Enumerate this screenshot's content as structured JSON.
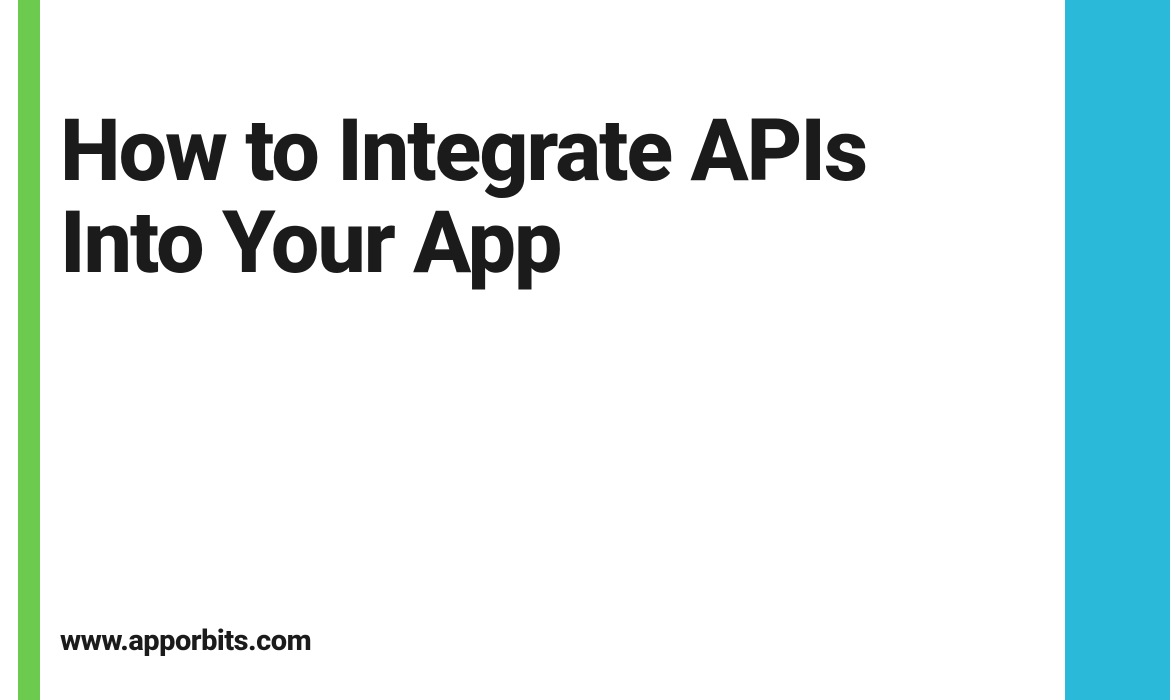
{
  "colors": {
    "left_bar": "#6CCB4F",
    "right_bar": "#2BB9D9",
    "text": "#1b1b1b",
    "background": "#ffffff"
  },
  "heading": {
    "line1": "How to Integrate APIs",
    "line2": "Into Your App"
  },
  "footer": {
    "site_url": "www.apporbits.com"
  }
}
